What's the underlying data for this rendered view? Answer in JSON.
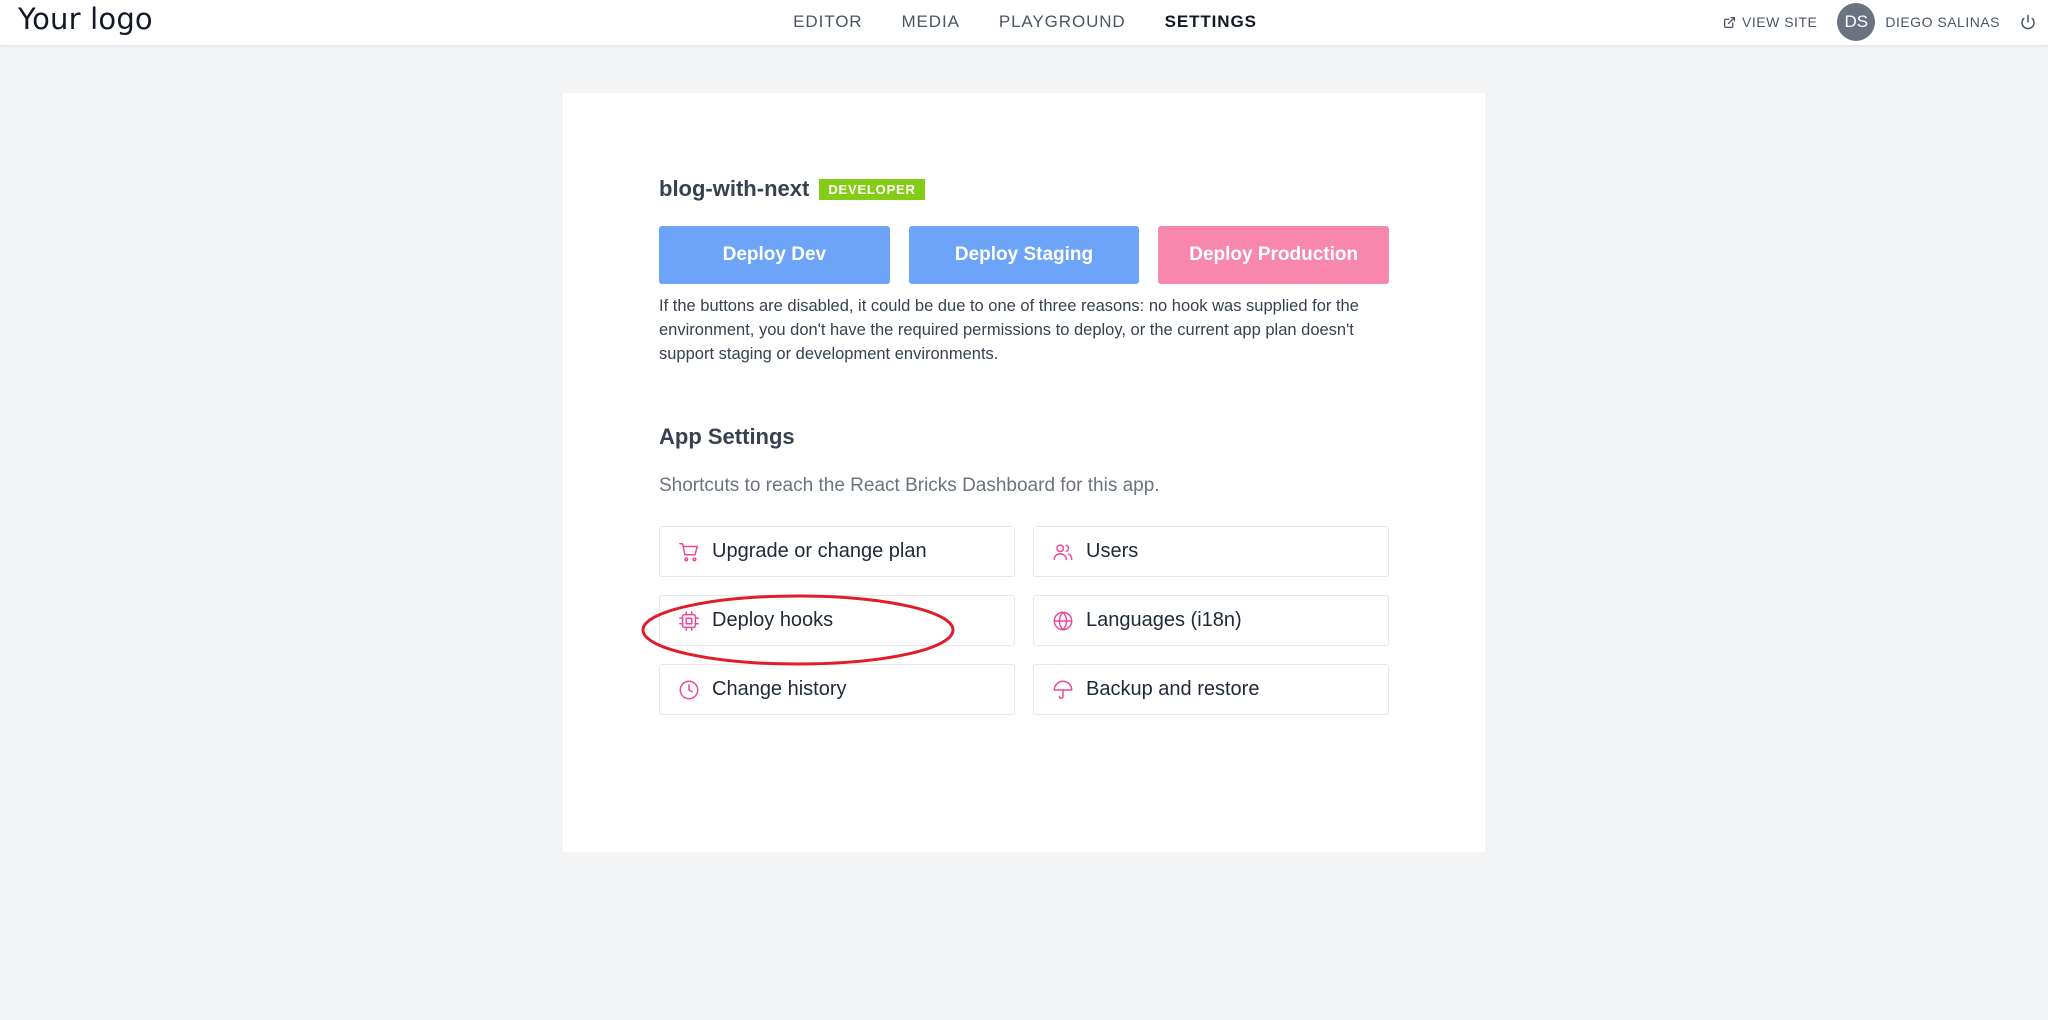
{
  "header": {
    "logo": "Your logo",
    "nav": [
      {
        "label": "EDITOR",
        "active": false
      },
      {
        "label": "MEDIA",
        "active": false
      },
      {
        "label": "PLAYGROUND",
        "active": false
      },
      {
        "label": "SETTINGS",
        "active": true
      }
    ],
    "view_site": "VIEW SITE",
    "view_site_icon": "external-link-icon",
    "avatar_initials": "DS",
    "user_name": "DIEGO SALINAS",
    "logout_icon": "power-icon"
  },
  "app": {
    "name": "blog-with-next",
    "badge": "DEVELOPER",
    "badge_color": "#84cc16"
  },
  "deploy": {
    "buttons": [
      {
        "label": "Deploy Dev",
        "color": "#6ea4f7"
      },
      {
        "label": "Deploy Staging",
        "color": "#6ea4f7"
      },
      {
        "label": "Deploy Production",
        "color": "#f787ad"
      }
    ],
    "note": "If the buttons are disabled, it could be due to one of three reasons: no hook was supplied for the environment, you don't have the required permissions to deploy, or the current app plan doesn't support staging or development environments."
  },
  "settings": {
    "title": "App Settings",
    "description": "Shortcuts to reach the React Bricks Dashboard for this app.",
    "icon_color": "#ec4899",
    "shortcuts": [
      {
        "label": "Upgrade or change plan",
        "icon": "cart-icon"
      },
      {
        "label": "Users",
        "icon": "users-icon"
      },
      {
        "label": "Deploy hooks",
        "icon": "chip-icon"
      },
      {
        "label": "Languages (i18n)",
        "icon": "globe-icon"
      },
      {
        "label": "Change history",
        "icon": "clock-icon"
      },
      {
        "label": "Backup and restore",
        "icon": "umbrella-icon"
      }
    ]
  },
  "annotation": {
    "highlighted_item": "Deploy hooks",
    "color": "#e11d2a"
  }
}
